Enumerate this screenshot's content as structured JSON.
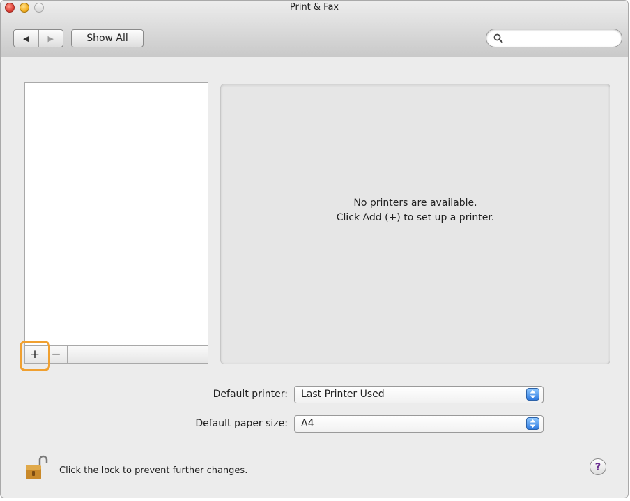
{
  "window": {
    "title": "Print & Fax"
  },
  "toolbar": {
    "back_glyph": "◀",
    "forward_glyph": "▶",
    "show_all_label": "Show All",
    "search_placeholder": ""
  },
  "printer_list": {
    "add_label": "+",
    "remove_label": "−",
    "items": []
  },
  "detail": {
    "message_line1": "No printers are available.",
    "message_line2": "Click Add (+) to set up a printer."
  },
  "defaults": {
    "printer_label": "Default printer:",
    "printer_value": "Last Printer Used",
    "paper_label": "Default paper size:",
    "paper_value": "A4"
  },
  "footer": {
    "lock_text": "Click the lock to prevent further changes.",
    "help_label": "?"
  },
  "icons": {
    "close": "close-icon",
    "minimize": "minimize-icon",
    "zoom": "zoom-icon",
    "search": "search-icon",
    "lock": "lock-icon",
    "help": "help-icon"
  },
  "colors": {
    "highlight": "#f0a030",
    "stepper": "#2f7be0",
    "help_glyph": "#6a2d91"
  }
}
